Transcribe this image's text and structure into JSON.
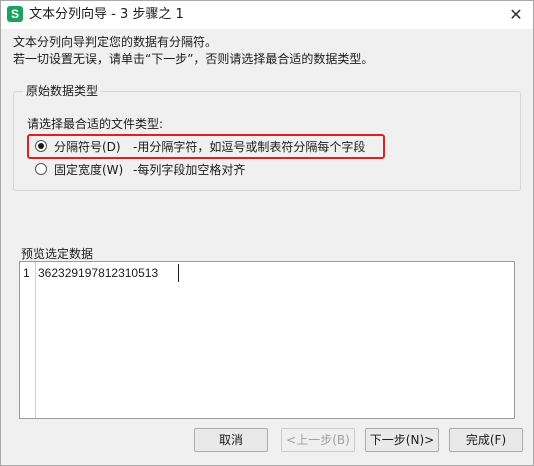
{
  "window": {
    "title": "文本分列向导 - 3 步骤之 1",
    "app_icon_letter": "S",
    "close_icon": "close-icon",
    "accent_color": "#1aa261"
  },
  "intro": {
    "line1": "文本分列向导判定您的数据有分隔符。",
    "line2": "若一切设置无误，请单击“下一步”，否则请选择最合适的数据类型。"
  },
  "original_data_type": {
    "legend": "原始数据类型",
    "prompt": "请选择最合适的文件类型:",
    "options": [
      {
        "label": "分隔符号(D)",
        "description": "-用分隔字符，如逗号或制表符分隔每个字段",
        "selected": true
      },
      {
        "label": "固定宽度(W)",
        "description": "-每列字段加空格对齐",
        "selected": false
      }
    ],
    "highlight_color": "#e02020"
  },
  "preview": {
    "label": "预览选定数据",
    "rows": [
      {
        "line": "1",
        "text": "362329197812310513"
      }
    ]
  },
  "buttons": {
    "cancel": "取消",
    "prev": "<上一步(B)",
    "next": "下一步(N)>",
    "finish": "完成(F)"
  }
}
